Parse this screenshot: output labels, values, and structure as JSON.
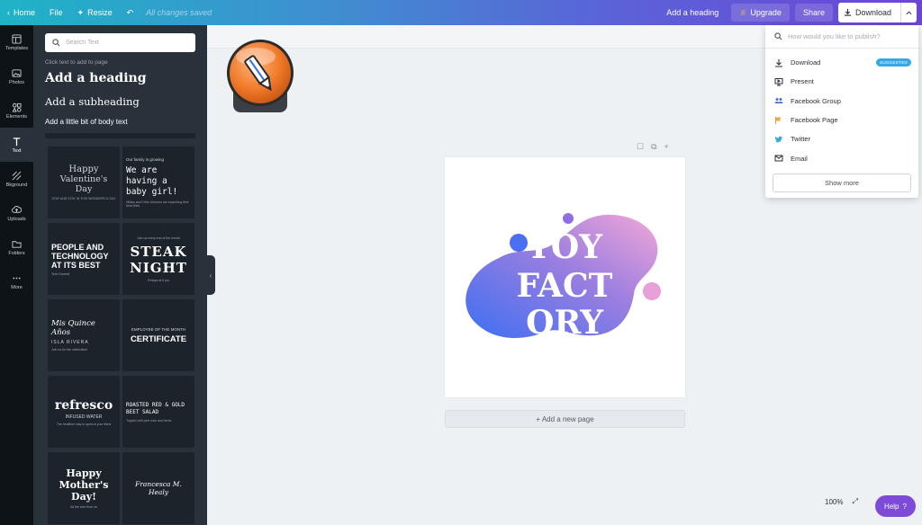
{
  "topbar": {
    "home": "Home",
    "file": "File",
    "resize": "Resize",
    "saved": "All changes saved",
    "add_heading": "Add a heading",
    "upgrade": "Upgrade",
    "share": "Share",
    "download": "Download"
  },
  "rail": {
    "items": [
      {
        "label": "Templates",
        "icon": "templates-icon"
      },
      {
        "label": "Photos",
        "icon": "photos-icon"
      },
      {
        "label": "Elements",
        "icon": "elements-icon"
      },
      {
        "label": "Text",
        "icon": "text-icon"
      },
      {
        "label": "Bkground",
        "icon": "background-icon"
      },
      {
        "label": "Uploads",
        "icon": "uploads-icon"
      },
      {
        "label": "Folders",
        "icon": "folders-icon"
      },
      {
        "label": "More",
        "icon": "more-icon"
      }
    ],
    "active": "Text"
  },
  "panel": {
    "search_placeholder": "Search Text",
    "hint": "Click text to add to page",
    "add_heading": "Add a heading",
    "add_subheading": "Add a subheading",
    "add_body": "Add a little bit of body text",
    "templates": [
      {
        "line1": "Happy",
        "line2": "Valentine's Day",
        "small": "STAY AND STAY IN THIS WONDERFUL DAY"
      },
      {
        "line1": "Our family is growing",
        "line2": "We are having a baby girl!",
        "small": "Hillary and Chris Johnson are expecting their third child"
      },
      {
        "line1": "PEOPLE AND TECHNOLOGY AT ITS BEST",
        "line2": "",
        "small": "Tech Summit"
      },
      {
        "line1": "Join us every end of the month",
        "line2": "STEAK NIGHT",
        "small": "Fridays at 5 pm"
      },
      {
        "line1": "Mis Quince Años",
        "line2": "ISLA RIVERA",
        "small": "Join us for the celebration"
      },
      {
        "line1": "EMPLOYEE OF THE MONTH",
        "line2": "CERTIFICATE",
        "small": ""
      },
      {
        "line1": "refresco",
        "line2": "INFUSED WATER",
        "small": "The healthier way to quench your thirst"
      },
      {
        "line1": "ROASTED RED & GOLD BEET SALAD",
        "line2": "",
        "small": "Topped with pine nuts and herbs"
      },
      {
        "line1": "Happy Mother's Day!",
        "line2": "",
        "small": "All the love from us"
      },
      {
        "line1": "Francesca M. Healy",
        "line2": "",
        "small": ""
      }
    ]
  },
  "canvas": {
    "design_words": [
      "TOY",
      "FACT",
      "ORY"
    ],
    "add_page": "+ Add a new page"
  },
  "publish": {
    "search_placeholder": "How would you like to publish?",
    "items": [
      {
        "label": "Download",
        "icon": "download-icon",
        "badge": "SUGGESTED"
      },
      {
        "label": "Present",
        "icon": "present-icon"
      },
      {
        "label": "Facebook Group",
        "icon": "facebook-group-icon"
      },
      {
        "label": "Facebook Page",
        "icon": "flag-icon"
      },
      {
        "label": "Twitter",
        "icon": "twitter-icon"
      },
      {
        "label": "Email",
        "icon": "email-icon"
      }
    ],
    "show_more": "Show more"
  },
  "footer": {
    "zoom": "100%",
    "help": "Help",
    "help_mark": "?"
  },
  "colors": {
    "gradient_start": "#1fb3c7",
    "gradient_end": "#6d45d6",
    "panel_bg": "#29313b",
    "help_bg": "#7d4bd8"
  }
}
